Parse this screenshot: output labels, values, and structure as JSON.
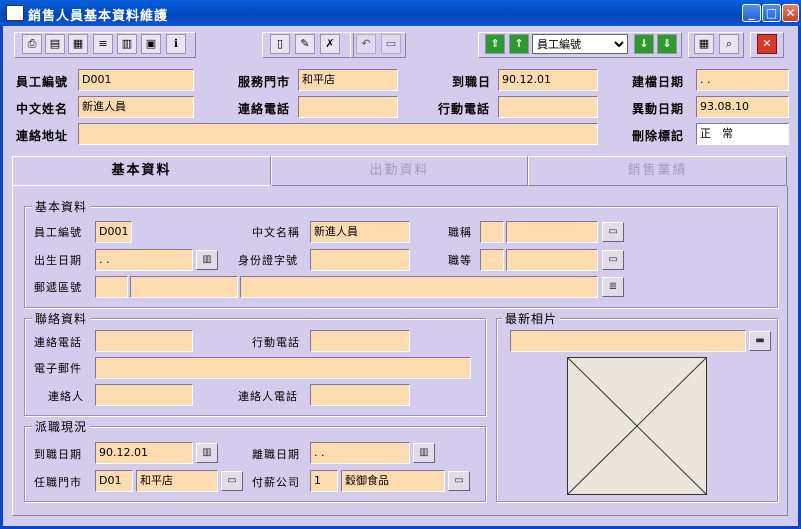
{
  "window": {
    "title": "銷售人員基本資料維護"
  },
  "toolbar": {
    "combo_value": "員工編號"
  },
  "header": {
    "emp_no": {
      "label": "員工編號",
      "value": "D001"
    },
    "store": {
      "label": "服務門市",
      "value": "和平店"
    },
    "hire_date": {
      "label": "到職日",
      "value": "90.12.01"
    },
    "create_date": {
      "label": "建檔日期",
      "value": ". ."
    },
    "name": {
      "label": "中文姓名",
      "value": "新進人員"
    },
    "phone": {
      "label": "連絡電話",
      "value": ""
    },
    "mobile": {
      "label": "行動電話",
      "value": ""
    },
    "change_date": {
      "label": "異動日期",
      "value": "93.08.10"
    },
    "address": {
      "label": "連絡地址",
      "value": ""
    },
    "delete_flag": {
      "label": "刪除標記",
      "value": "正　常"
    }
  },
  "tabs": [
    "基本資料",
    "出勤資料",
    "銷售業績"
  ],
  "basic": {
    "title": "基本資料",
    "emp_no_label": "員工編號",
    "emp_no": "D001",
    "cname_label": "中文名稱",
    "cname": "新進人員",
    "title_label": "職稱",
    "birth_label": "出生日期",
    "birth": ". .",
    "id_label": "身份證字號",
    "grade_label": "職等",
    "zip_label": "郵遞區號"
  },
  "contact": {
    "title": "聯絡資料",
    "phone_label": "連絡電話",
    "mobile_label": "行動電話",
    "email_label": "電子郵件",
    "person_label": "連絡人",
    "person_phone_label": "連絡人電話"
  },
  "photo": {
    "title": "最新相片"
  },
  "assign": {
    "title": "派職現況",
    "hire_label": "到職日期",
    "hire": "90.12.01",
    "leave_label": "離職日期",
    "leave": ". .",
    "store_label": "任職門市",
    "store_code": "D01",
    "store_name": "和平店",
    "pay_label": "付薪公司",
    "pay_code": "1",
    "pay_name": "穀御食品"
  }
}
